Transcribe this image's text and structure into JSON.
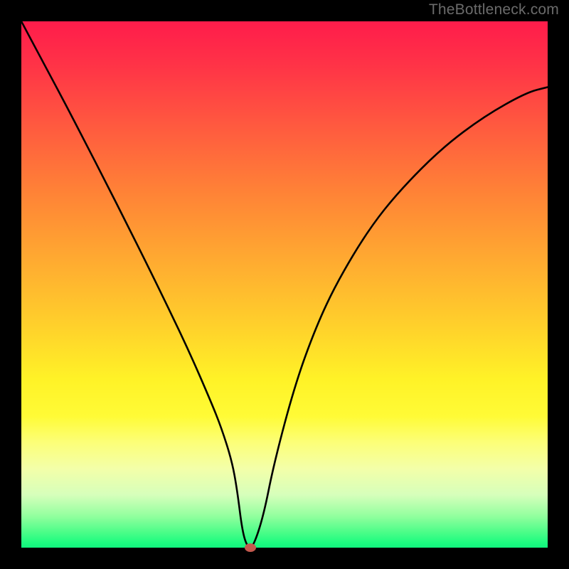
{
  "watermark": "TheBottleneck.com",
  "chart_data": {
    "type": "line",
    "title": "",
    "xlabel": "",
    "ylabel": "",
    "xlim": [
      0,
      100
    ],
    "ylim": [
      0,
      100
    ],
    "grid": false,
    "series": [
      {
        "name": "bottleneck-curve",
        "x": [
          0,
          4,
          8,
          12,
          16,
          20,
          24,
          28,
          32,
          36,
          38,
          40,
          41,
          42,
          43,
          44,
          46,
          48,
          52,
          56,
          60,
          66,
          72,
          80,
          88,
          96,
          100
        ],
        "y": [
          100,
          92.5,
          85,
          77.3,
          69.5,
          61.6,
          53.6,
          45.4,
          37,
          27.8,
          22.8,
          16.5,
          11,
          3,
          0,
          0,
          6,
          16,
          31,
          42,
          50.5,
          60.5,
          68,
          76,
          82,
          86.5,
          87.5
        ]
      }
    ],
    "marker": {
      "name": "min-point",
      "x": 43.5,
      "y": 0,
      "color": "#c4594e"
    },
    "gradient_stops": [
      {
        "pos": 0,
        "color": "#ff1c4b"
      },
      {
        "pos": 8,
        "color": "#ff3247"
      },
      {
        "pos": 20,
        "color": "#ff5a3f"
      },
      {
        "pos": 33,
        "color": "#ff8436"
      },
      {
        "pos": 45,
        "color": "#ffa931"
      },
      {
        "pos": 58,
        "color": "#ffd12b"
      },
      {
        "pos": 68,
        "color": "#fff227"
      },
      {
        "pos": 75,
        "color": "#fffb36"
      },
      {
        "pos": 80,
        "color": "#fcff78"
      },
      {
        "pos": 85,
        "color": "#f3ffa9"
      },
      {
        "pos": 90,
        "color": "#d6ffbb"
      },
      {
        "pos": 94,
        "color": "#92ff9e"
      },
      {
        "pos": 97,
        "color": "#4dfd89"
      },
      {
        "pos": 99,
        "color": "#1efc80"
      },
      {
        "pos": 100,
        "color": "#11f37e"
      }
    ]
  }
}
